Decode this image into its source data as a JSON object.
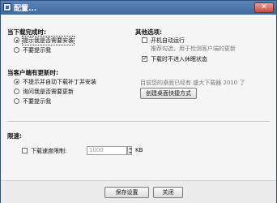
{
  "window": {
    "title": "配置...",
    "close_glyph": "✕"
  },
  "download_complete": {
    "heading": "当下载完成时:",
    "options": [
      {
        "label": "提示我是否需要安装",
        "selected": true
      },
      {
        "label": "不要提示我",
        "selected": false
      }
    ]
  },
  "client_update": {
    "heading": "当客户端有更新时:",
    "options": [
      {
        "label": "不提示并自动下载补丁并安装",
        "selected": true
      },
      {
        "label": "询问我是否需要更新",
        "selected": false
      },
      {
        "label": "不要提示我",
        "selected": false
      }
    ]
  },
  "other_options": {
    "heading": "其他选项:",
    "autostart_label": "开机自动运行",
    "autostart_checked": false,
    "autostart_hint": "推荐勾选，用于检测客户端的更新",
    "no_sleep_label": "下载时不进入休眠状态",
    "no_sleep_checked": true,
    "desktop_note": "目前您的桌面已经有 盛大下载器 2010 了",
    "create_shortcut_label": "创建桌面快捷方式"
  },
  "speed_limit": {
    "heading": "限速:",
    "checkbox_label": "下载速度限制:",
    "checked": false,
    "value": "1000",
    "unit": "KB"
  },
  "footer": {
    "save_label": "保存设置",
    "close_label": "关闭"
  },
  "colors": {
    "titlebar": "#3d6aa3",
    "window_bg": "#f5f5f5"
  }
}
